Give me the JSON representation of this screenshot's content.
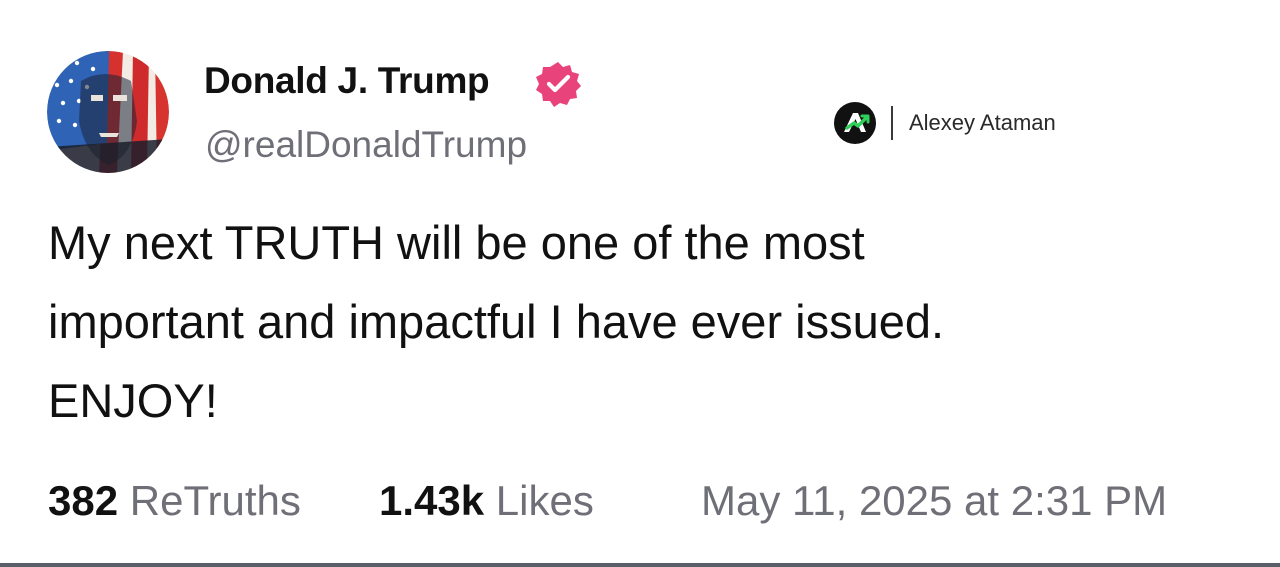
{
  "author": {
    "name": "Donald J. Trump",
    "handle": "@realDonaldTrump",
    "verified": true,
    "avatar_icon": "flag-portrait-avatar",
    "verified_icon": "verified-badge-icon",
    "verified_color": "#e8437a"
  },
  "watermark": {
    "logo_icon": "alexey-ataman-logo-icon",
    "text": "Alexey Ataman"
  },
  "post": {
    "lines": [
      "My next TRUTH will be one of the most",
      "important and impactful I have ever issued.",
      "ENJOY!"
    ]
  },
  "stats": {
    "retruths_count": "382",
    "retruths_label": "ReTruths",
    "likes_count": "1.43k",
    "likes_label": "Likes",
    "timestamp": "May 11, 2025 at 2:31 PM"
  },
  "colors": {
    "text_primary": "#111111",
    "text_secondary": "#6f6f78",
    "background": "#ffffff"
  }
}
